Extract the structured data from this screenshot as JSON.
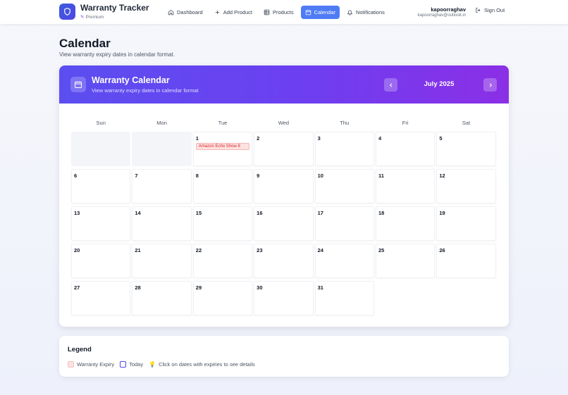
{
  "brand": {
    "title": "Warranty Tracker",
    "tier": "Premium"
  },
  "nav": {
    "items": [
      {
        "label": "Dashboard",
        "icon": "home-icon",
        "active": false
      },
      {
        "label": "Add Product",
        "icon": "plus-icon",
        "active": false
      },
      {
        "label": "Products",
        "icon": "grid-icon",
        "active": false
      },
      {
        "label": "Calendar",
        "icon": "calendar-icon",
        "active": true
      },
      {
        "label": "Notifications",
        "icon": "bell-icon",
        "active": false
      }
    ]
  },
  "user": {
    "name": "kapoorraghav",
    "email": "kapoorraghav@outlook.in",
    "signout_label": "Sign Out"
  },
  "page": {
    "title": "Calendar",
    "subtitle": "View warranty expiry dates in calendar format."
  },
  "calendar": {
    "title": "Warranty Calendar",
    "subtitle": "View warranty expiry dates in calendar format",
    "month_label": "July 2025",
    "weekdays": [
      "Sun",
      "Mon",
      "Tue",
      "Wed",
      "Thu",
      "Fri",
      "Sat"
    ],
    "leading_empty_days": 2,
    "days_in_month": 31,
    "events": [
      {
        "day": 1,
        "label": "Amazon Echo Show 8"
      }
    ]
  },
  "legend": {
    "title": "Legend",
    "expiry_label": "Warranty Expiry",
    "today_label": "Today",
    "hint": "Click on dates with expiries to see details"
  },
  "colors": {
    "accent": "#4f7cf5",
    "header_start": "#5b4ef0",
    "header_end": "#8b2fe6",
    "expiry_bg": "#fde2e2",
    "expiry_text": "#dc2626"
  }
}
